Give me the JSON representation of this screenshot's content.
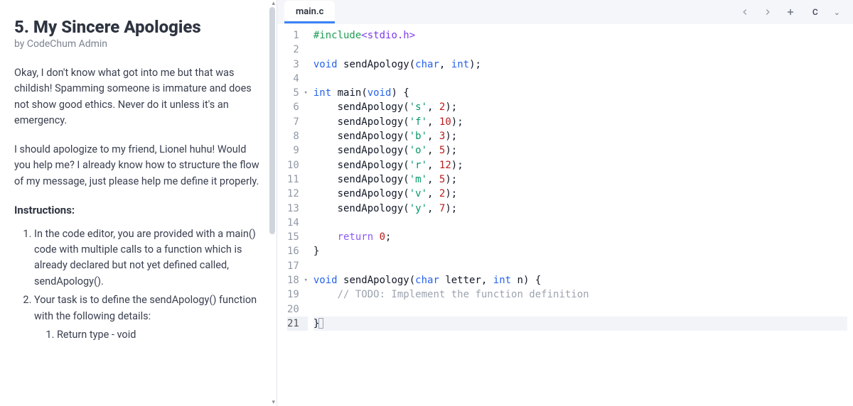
{
  "problem": {
    "title": "5. My Sincere Apologies",
    "author": "by CodeChum Admin",
    "para1": "Okay, I don't know what got into me but that was childish! Spamming someone is immature and does not show good ethics. Never do it unless it's an emergency.",
    "para2": "I should apologize to my friend, Lionel huhu! Would you help me? I already know how to structure the flow of my message, just please help me define it properly.",
    "instructions_heading": "Instructions:",
    "inst1": "In the code editor, you are provided with a main() code with multiple calls to a function which is already declared but not yet defined called, sendApology().",
    "inst2": "Your task is to define the sendApology() function with the following details:",
    "inst2_1": "Return type - void"
  },
  "tabs": {
    "file": "main.c",
    "language": "C"
  },
  "code": {
    "lines": [
      {
        "n": 1,
        "fold": "",
        "html": "<span class='tok-pp'>#include</span><span class='tok-inc'>&lt;stdio.h&gt;</span>"
      },
      {
        "n": 2,
        "fold": "",
        "html": ""
      },
      {
        "n": 3,
        "fold": "",
        "html": "<span class='tok-type'>void</span> <span class='tok-fn'>sendApology</span><span class='tok-paren'>(</span><span class='tok-type'>char</span><span class='tok-punc'>,</span> <span class='tok-type'>int</span><span class='tok-paren'>)</span><span class='tok-punc'>;</span>"
      },
      {
        "n": 4,
        "fold": "",
        "html": ""
      },
      {
        "n": 5,
        "fold": "▾",
        "html": "<span class='tok-type'>int</span> <span class='tok-fn'>main</span><span class='tok-paren'>(</span><span class='tok-type'>void</span><span class='tok-paren'>)</span> <span class='tok-punc'>{</span>"
      },
      {
        "n": 6,
        "fold": "",
        "html": "    <span class='tok-fn'>sendApology</span><span class='tok-paren'>(</span><span class='tok-str'>'s'</span><span class='tok-punc'>,</span> <span class='tok-num'>2</span><span class='tok-paren'>)</span><span class='tok-punc'>;</span>"
      },
      {
        "n": 7,
        "fold": "",
        "html": "    <span class='tok-fn'>sendApology</span><span class='tok-paren'>(</span><span class='tok-str'>'f'</span><span class='tok-punc'>,</span> <span class='tok-num'>10</span><span class='tok-paren'>)</span><span class='tok-punc'>;</span>"
      },
      {
        "n": 8,
        "fold": "",
        "html": "    <span class='tok-fn'>sendApology</span><span class='tok-paren'>(</span><span class='tok-str'>'b'</span><span class='tok-punc'>,</span> <span class='tok-num'>3</span><span class='tok-paren'>)</span><span class='tok-punc'>;</span>"
      },
      {
        "n": 9,
        "fold": "",
        "html": "    <span class='tok-fn'>sendApology</span><span class='tok-paren'>(</span><span class='tok-str'>'o'</span><span class='tok-punc'>,</span> <span class='tok-num'>5</span><span class='tok-paren'>)</span><span class='tok-punc'>;</span>"
      },
      {
        "n": 10,
        "fold": "",
        "html": "    <span class='tok-fn'>sendApology</span><span class='tok-paren'>(</span><span class='tok-str'>'r'</span><span class='tok-punc'>,</span> <span class='tok-num'>12</span><span class='tok-paren'>)</span><span class='tok-punc'>;</span>"
      },
      {
        "n": 11,
        "fold": "",
        "html": "    <span class='tok-fn'>sendApology</span><span class='tok-paren'>(</span><span class='tok-str'>'m'</span><span class='tok-punc'>,</span> <span class='tok-num'>5</span><span class='tok-paren'>)</span><span class='tok-punc'>;</span>"
      },
      {
        "n": 12,
        "fold": "",
        "html": "    <span class='tok-fn'>sendApology</span><span class='tok-paren'>(</span><span class='tok-str'>'v'</span><span class='tok-punc'>,</span> <span class='tok-num'>2</span><span class='tok-paren'>)</span><span class='tok-punc'>;</span>"
      },
      {
        "n": 13,
        "fold": "",
        "html": "    <span class='tok-fn'>sendApology</span><span class='tok-paren'>(</span><span class='tok-str'>'y'</span><span class='tok-punc'>,</span> <span class='tok-num'>7</span><span class='tok-paren'>)</span><span class='tok-punc'>;</span>"
      },
      {
        "n": 14,
        "fold": "",
        "html": ""
      },
      {
        "n": 15,
        "fold": "",
        "html": "    <span class='tok-kw'>return</span> <span class='tok-num'>0</span><span class='tok-punc'>;</span>"
      },
      {
        "n": 16,
        "fold": "",
        "html": "<span class='tok-punc'>}</span>"
      },
      {
        "n": 17,
        "fold": "",
        "html": ""
      },
      {
        "n": 18,
        "fold": "▾",
        "html": "<span class='tok-type'>void</span> <span class='tok-fn'>sendApology</span><span class='tok-paren'>(</span><span class='tok-type'>char</span> <span class='tok-id'>letter</span><span class='tok-punc'>,</span> <span class='tok-type'>int</span> <span class='tok-id'>n</span><span class='tok-paren'>)</span> <span class='tok-punc'>{</span>"
      },
      {
        "n": 19,
        "fold": "",
        "html": "    <span class='tok-cmt'>// TODO: Implement the function definition</span>"
      },
      {
        "n": 20,
        "fold": "",
        "html": ""
      },
      {
        "n": 21,
        "fold": "",
        "active": true,
        "html": "<span class='tok-punc'>}</span><span class='cursor-box'></span>"
      }
    ]
  }
}
